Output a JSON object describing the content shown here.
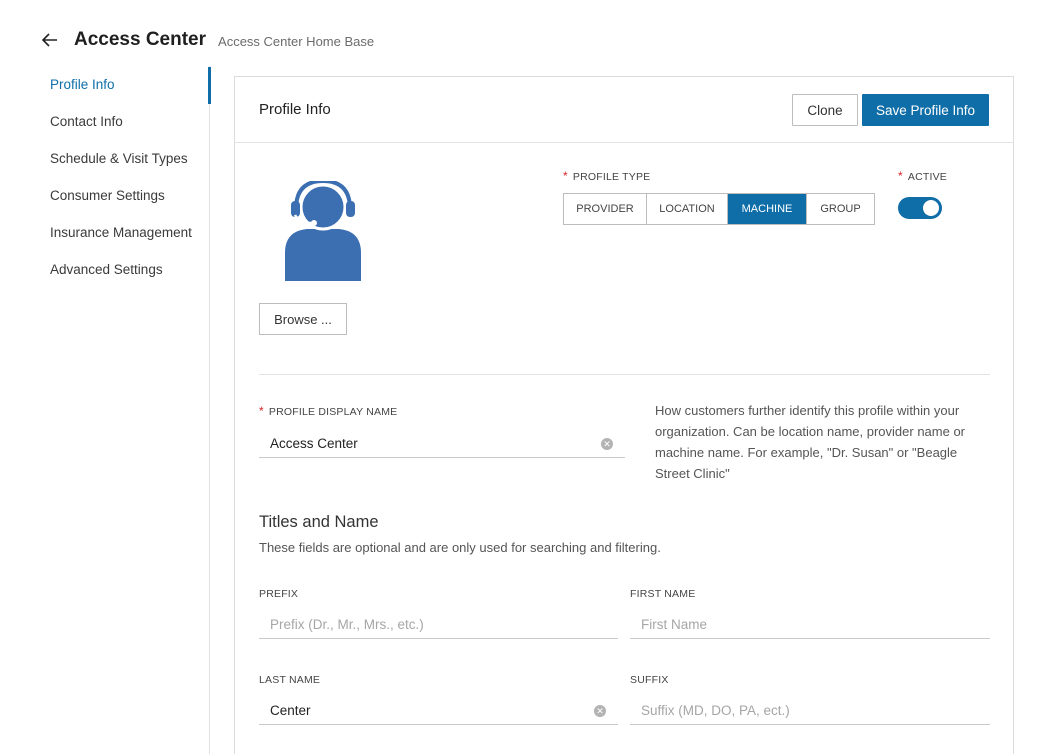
{
  "header": {
    "title": "Access Center",
    "subtitle": "Access Center Home Base"
  },
  "sidebar": {
    "items": [
      {
        "label": "Profile Info",
        "active": true
      },
      {
        "label": "Contact Info"
      },
      {
        "label": "Schedule & Visit Types"
      },
      {
        "label": "Consumer Settings"
      },
      {
        "label": "Insurance Management"
      },
      {
        "label": "Advanced Settings"
      }
    ]
  },
  "panel": {
    "title": "Profile Info",
    "clone_label": "Clone",
    "save_label": "Save Profile Info"
  },
  "avatar": {
    "icon": "headset-user-icon",
    "browse_label": "Browse ..."
  },
  "profile_type": {
    "label": "PROFILE TYPE",
    "options": [
      "PROVIDER",
      "LOCATION",
      "MACHINE",
      "GROUP"
    ],
    "selected": "MACHINE"
  },
  "active": {
    "label": "ACTIVE",
    "on": true
  },
  "display_name": {
    "label": "PROFILE DISPLAY NAME",
    "value": "Access Center",
    "help": "How customers further identify this profile within your organization. Can be location name, provider name or machine name. For example, \"Dr. Susan\" or \"Beagle Street Clinic\""
  },
  "titles": {
    "heading": "Titles and Name",
    "subheading": "These fields are optional and are only used for searching and filtering.",
    "prefix": {
      "label": "PREFIX",
      "value": "",
      "placeholder": "Prefix (Dr., Mr., Mrs., etc.)"
    },
    "first_name": {
      "label": "FIRST NAME",
      "value": "",
      "placeholder": "First Name"
    },
    "last_name": {
      "label": "LAST NAME",
      "value": "Center",
      "placeholder": ""
    },
    "suffix": {
      "label": "SUFFIX",
      "value": "",
      "placeholder": "Suffix (MD, DO, PA, ect.)"
    }
  },
  "colors": {
    "accent": "#0f6ea8",
    "required": "#d8252a",
    "avatar": "#3b6fb1"
  }
}
